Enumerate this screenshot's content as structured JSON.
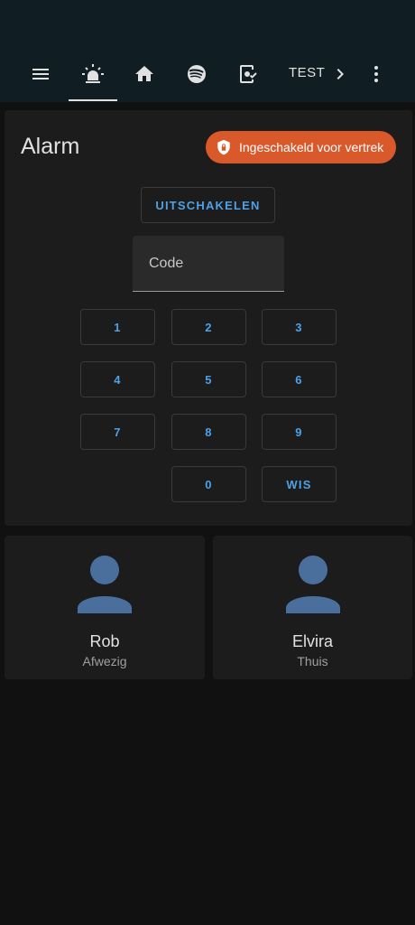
{
  "header": {
    "tabs": [
      {
        "icon": "menu-icon"
      },
      {
        "icon": "alarm-light-icon",
        "active": true
      },
      {
        "icon": "home-icon"
      },
      {
        "icon": "spotify-icon"
      },
      {
        "icon": "tablet-dashboard-icon"
      }
    ],
    "text_tab": "TEST",
    "more_icon": "dots-vertical-icon",
    "scroll_icon": "chevron-right-icon"
  },
  "alarm": {
    "title": "Alarm",
    "state": "Ingeschakeld voor vertrek",
    "state_color": "#d9592a",
    "disarm_label": "UITSCHAKELEN",
    "code_label": "Code",
    "keys": [
      "1",
      "2",
      "3",
      "4",
      "5",
      "6",
      "7",
      "8",
      "9",
      "0"
    ],
    "clear_label": "WIS",
    "accent": "#4ea1e6"
  },
  "persons": [
    {
      "name": "Rob",
      "state": "Afwezig"
    },
    {
      "name": "Elvira",
      "state": "Thuis"
    }
  ]
}
